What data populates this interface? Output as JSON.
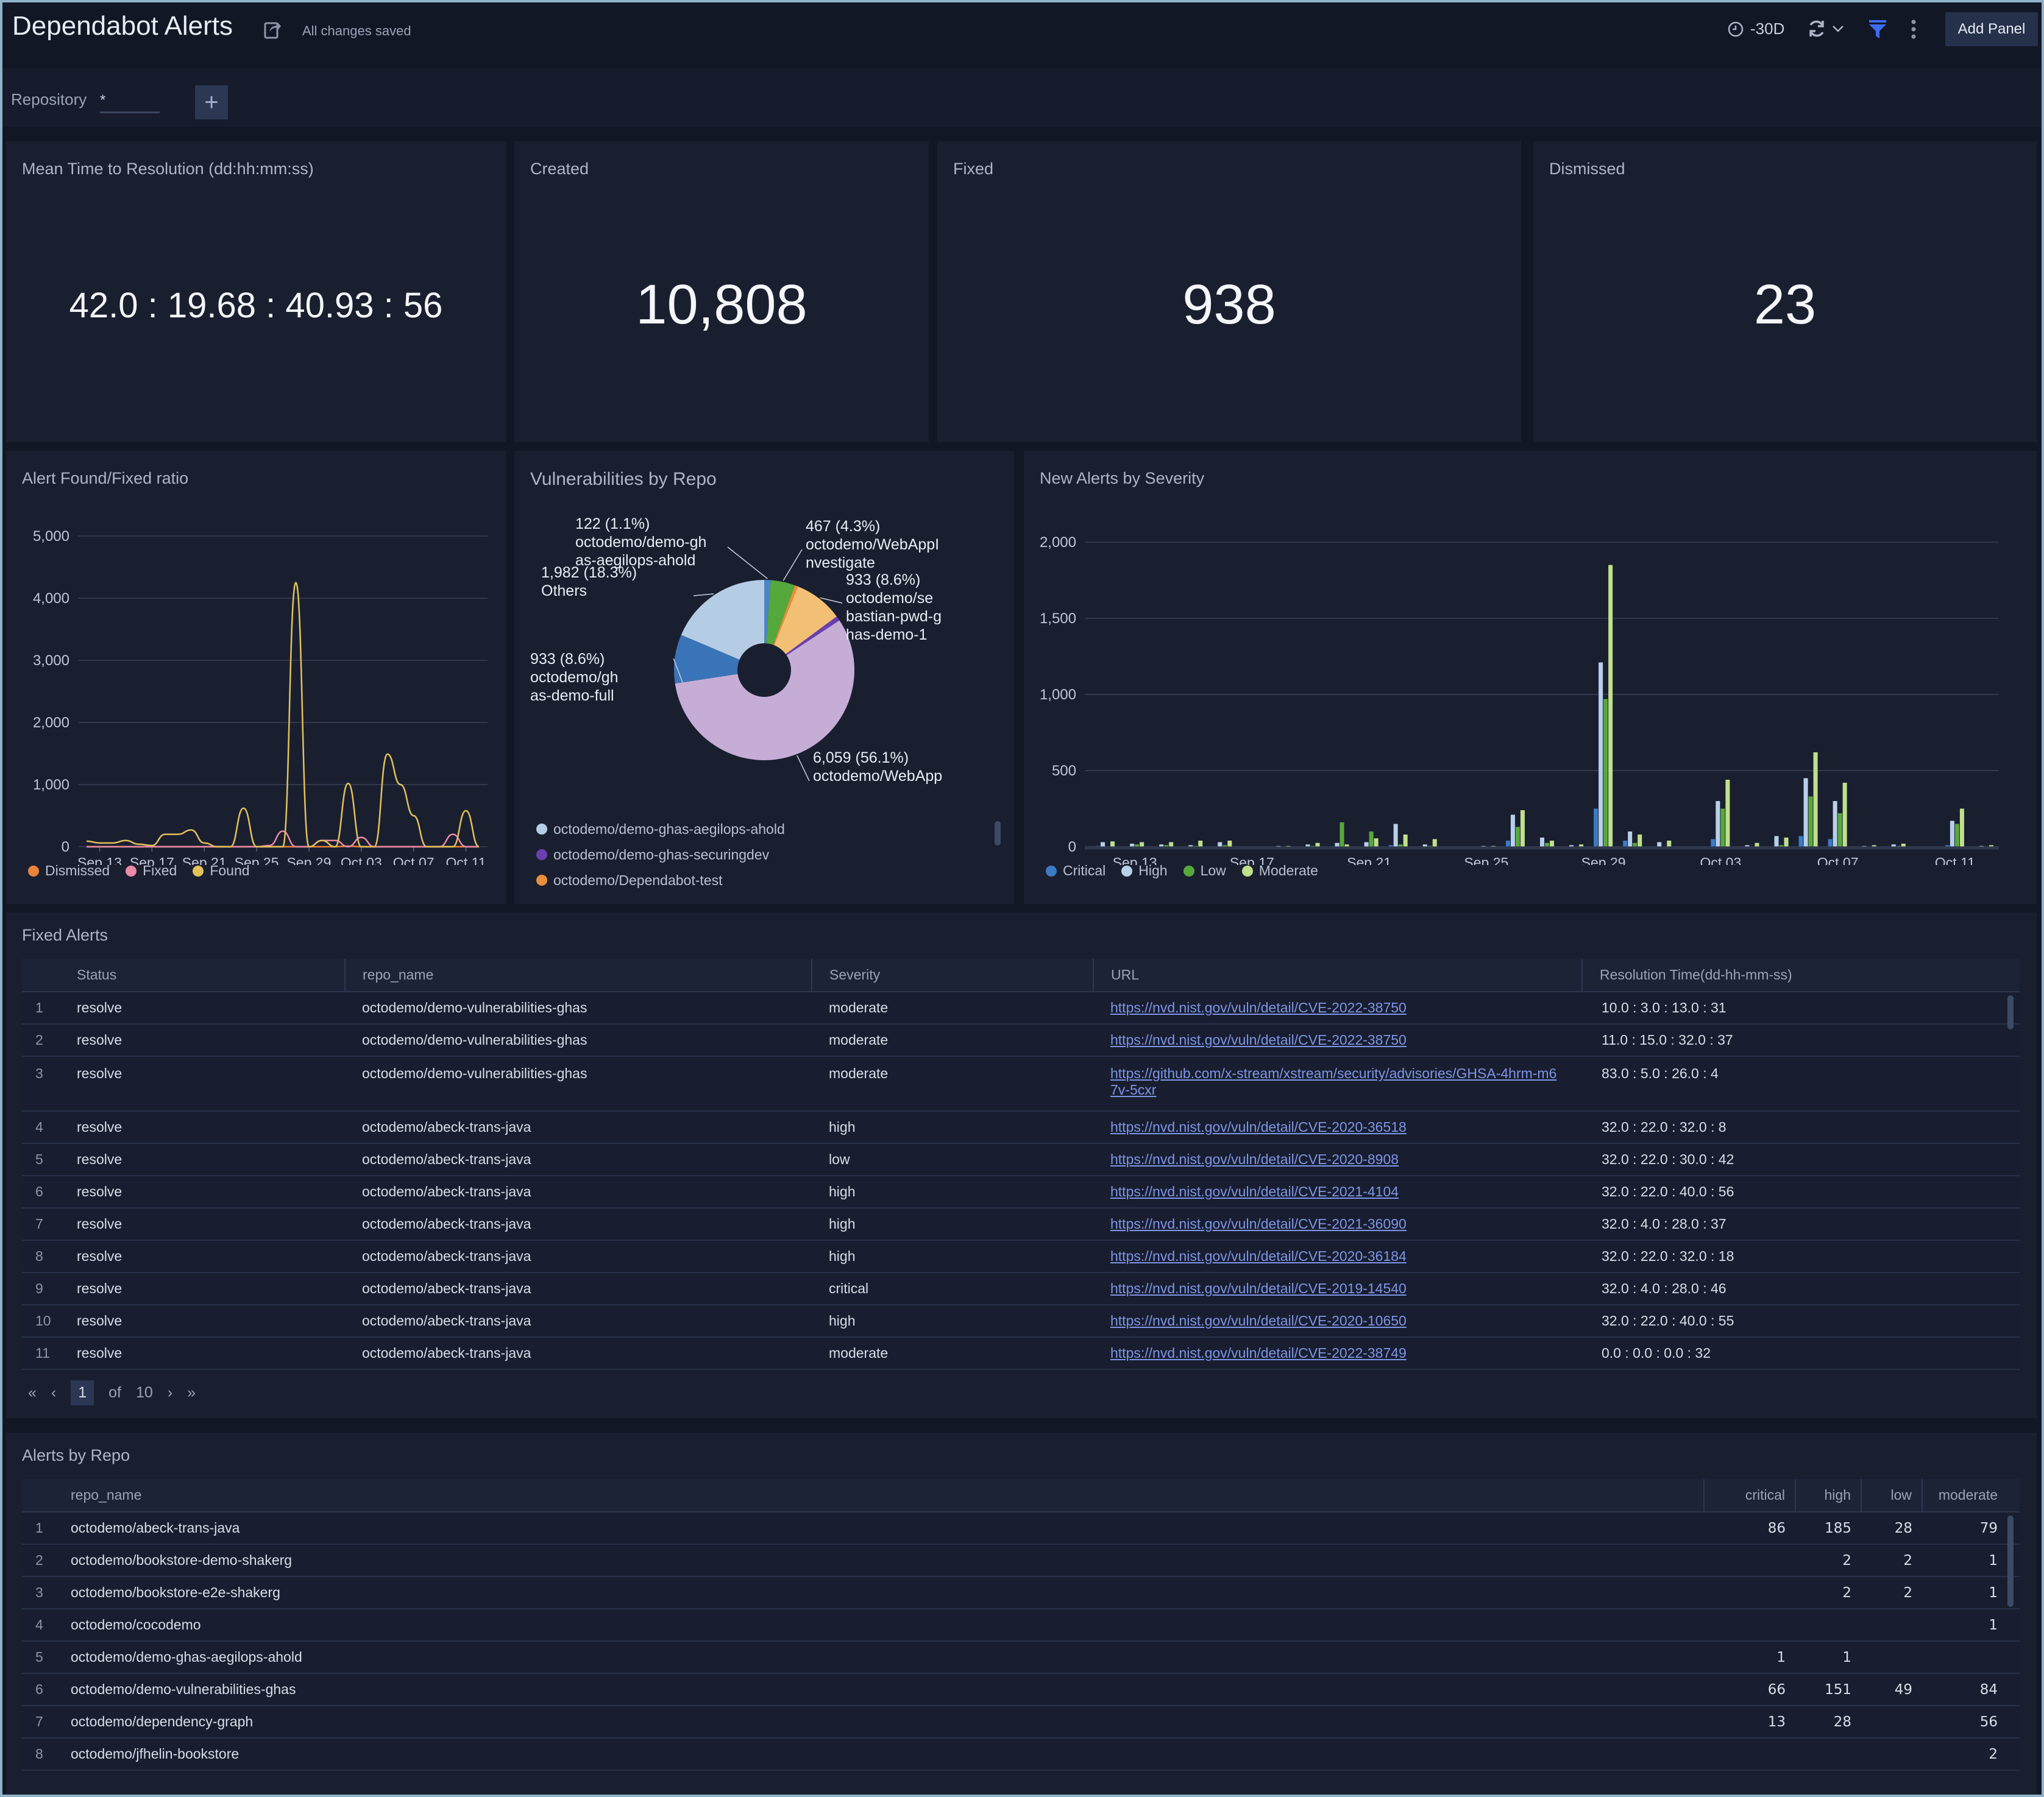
{
  "header": {
    "title": "Dependabot Alerts",
    "save_status": "All changes saved",
    "time_range": "-30D",
    "add_panel_label": "Add Panel"
  },
  "filters": {
    "repository_label": "Repository",
    "repository_value": "*"
  },
  "stats": [
    {
      "title": "Mean Time to Resolution (dd:hh:mm:ss)",
      "value": "42.0 : 19.68 : 40.93 : 56"
    },
    {
      "title": "Created",
      "value": "10,808"
    },
    {
      "title": "Fixed",
      "value": "938"
    },
    {
      "title": "Dismissed",
      "value": "23"
    }
  ],
  "chart_data": [
    {
      "type": "line",
      "title": "Alert Found/Fixed ratio",
      "xlabel": "",
      "ylabel": "",
      "ylim": [
        0,
        5000
      ],
      "yticks": [
        "0",
        "1,000",
        "2,000",
        "3,000",
        "4,000",
        "5,000"
      ],
      "x": [
        "Sep 12",
        "Sep 13",
        "Sep 14",
        "Sep 15",
        "Sep 16",
        "Sep 17",
        "Sep 18",
        "Sep 19",
        "Sep 20",
        "Sep 21",
        "Sep 22",
        "Sep 23",
        "Sep 24",
        "Sep 25",
        "Sep 26",
        "Sep 27",
        "Sep 28",
        "Sep 29",
        "Sep 30",
        "Oct 01",
        "Oct 02",
        "Oct 03",
        "Oct 04",
        "Oct 05",
        "Oct 06",
        "Oct 07",
        "Oct 08",
        "Oct 09",
        "Oct 10",
        "Oct 11",
        "Oct 12"
      ],
      "xticks": [
        "Sep 13",
        "Sep 17",
        "Sep 21",
        "Sep 25",
        "Sep 29",
        "Oct 03",
        "Oct 07",
        "Oct 11"
      ],
      "legend": "bottom-left",
      "grid": true,
      "series": [
        {
          "name": "Dismissed",
          "color": "#e8843a",
          "values": [
            0,
            0,
            0,
            0,
            0,
            0,
            0,
            0,
            0,
            0,
            0,
            0,
            0,
            0,
            0,
            0,
            0,
            0,
            0,
            0,
            10,
            0,
            0,
            0,
            0,
            0,
            0,
            0,
            0,
            0,
            0
          ]
        },
        {
          "name": "Fixed",
          "color": "#e98aa6",
          "values": [
            0,
            0,
            0,
            0,
            0,
            0,
            0,
            0,
            0,
            0,
            0,
            0,
            0,
            0,
            20,
            250,
            0,
            0,
            100,
            100,
            0,
            150,
            0,
            0,
            0,
            0,
            0,
            0,
            200,
            0,
            0
          ]
        },
        {
          "name": "Found",
          "color": "#e2c15a",
          "values": [
            90,
            60,
            60,
            100,
            40,
            20,
            200,
            200,
            270,
            60,
            0,
            0,
            620,
            0,
            0,
            0,
            4250,
            0,
            100,
            0,
            1020,
            0,
            0,
            1490,
            1000,
            500,
            0,
            0,
            0,
            580,
            0
          ]
        }
      ]
    },
    {
      "type": "pie",
      "title": "Vulnerabilities by Repo",
      "slices": [
        {
          "label": "octodemo/WebApp",
          "value": 6059,
          "pct": "56.1%",
          "color": "#c6add6",
          "annotation": [
            "6,059 (56.1%)",
            "octodemo/WebApp"
          ]
        },
        {
          "label": "octodemo/ghas-demo-full",
          "value": 933,
          "pct": "8.6%",
          "color": "#3a74b8",
          "annotation": [
            "933 (8.6%)",
            "octodemo/gh",
            "as-demo-full"
          ]
        },
        {
          "label": "Others",
          "value": 1982,
          "pct": "18.3%",
          "color": "#b5cde4",
          "annotation": [
            "1,982 (18.3%)",
            "Others"
          ]
        },
        {
          "label": "octodemo/demo-ghas-aegilops-ahold",
          "value": 122,
          "pct": "1.1%",
          "color": "#4a86c8",
          "annotation": [
            "122 (1.1%)",
            "octodemo/demo-gh",
            "as-aegilops-ahold"
          ]
        },
        {
          "label": "octodemo/WebAppInvestigate",
          "value": 467,
          "pct": "4.3%",
          "color": "#55a83b",
          "annotation": [
            "467 (4.3%)",
            "octodemo/WebAppI",
            "nvestigate"
          ]
        },
        {
          "label": "octodemo/Dependabot-test",
          "value": 60,
          "pct": "0.6%",
          "color": "#e98e3a",
          "annotation": []
        },
        {
          "label": "octodemo/sebastian-pwd-ghas-demo-1",
          "value": 933,
          "pct": "8.6%",
          "color": "#f2c074",
          "annotation": [
            "933 (8.6%)",
            "octodemo/se",
            "bastian-pwd-g",
            "has-demo-1"
          ]
        },
        {
          "label": "octodemo/demo-ghas-securingdev",
          "value": 90,
          "pct": "0.8%",
          "color": "#6a3fb0",
          "annotation": []
        }
      ],
      "legend_items": [
        {
          "label": "octodemo/demo-ghas-aegilops-ahold",
          "color": "#b5cde4"
        },
        {
          "label": "octodemo/demo-ghas-securingdev",
          "color": "#6a3fb0"
        },
        {
          "label": "octodemo/Dependabot-test",
          "color": "#e98e3a"
        }
      ]
    },
    {
      "type": "bar",
      "title": "New Alerts by Severity",
      "xlabel": "",
      "ylabel": "",
      "ylim": [
        0,
        2000
      ],
      "yticks": [
        "0",
        "500",
        "1,000",
        "1,500",
        "2,000"
      ],
      "categories": [
        "Sep 12",
        "Sep 13",
        "Sep 14",
        "Sep 15",
        "Sep 16",
        "Sep 17",
        "Sep 18",
        "Sep 19",
        "Sep 20",
        "Sep 21",
        "Sep 22",
        "Sep 23",
        "Sep 24",
        "Sep 25",
        "Sep 26",
        "Sep 27",
        "Sep 28",
        "Sep 29",
        "Sep 30",
        "Oct 01",
        "Oct 02",
        "Oct 03",
        "Oct 04",
        "Oct 05",
        "Oct 06",
        "Oct 07",
        "Oct 08",
        "Oct 09",
        "Oct 10",
        "Oct 11",
        "Oct 12"
      ],
      "xticks": [
        "Sep 13",
        "Sep 17",
        "Sep 21",
        "Sep 25",
        "Sep 29",
        "Oct 03",
        "Oct 07",
        "Oct 11"
      ],
      "legend": "bottom-left",
      "grid": true,
      "series": [
        {
          "name": "Critical",
          "color": "#3b7bc4",
          "values": [
            5,
            0,
            0,
            0,
            0,
            0,
            0,
            0,
            0,
            0,
            10,
            0,
            0,
            0,
            40,
            0,
            0,
            250,
            40,
            0,
            0,
            50,
            0,
            0,
            70,
            50,
            0,
            0,
            0,
            10,
            0
          ]
        },
        {
          "name": "High",
          "color": "#b7d0ea",
          "values": [
            30,
            20,
            15,
            10,
            30,
            0,
            5,
            15,
            25,
            30,
            150,
            15,
            0,
            5,
            210,
            60,
            10,
            1210,
            100,
            30,
            0,
            300,
            10,
            70,
            450,
            300,
            5,
            15,
            0,
            170,
            5
          ]
        },
        {
          "name": "Low",
          "color": "#57a83d",
          "values": [
            0,
            15,
            10,
            5,
            10,
            0,
            0,
            5,
            160,
            100,
            15,
            5,
            0,
            0,
            130,
            25,
            0,
            970,
            25,
            0,
            0,
            250,
            0,
            10,
            330,
            220,
            0,
            5,
            0,
            150,
            0
          ]
        },
        {
          "name": "Moderate",
          "color": "#c1df8c",
          "values": [
            35,
            30,
            30,
            40,
            40,
            0,
            5,
            25,
            15,
            55,
            80,
            50,
            0,
            5,
            240,
            40,
            15,
            1850,
            80,
            40,
            0,
            440,
            25,
            60,
            620,
            420,
            10,
            20,
            0,
            250,
            10
          ]
        }
      ]
    }
  ],
  "fixed_alerts": {
    "title": "Fixed Alerts",
    "columns": [
      "Status",
      "repo_name",
      "Severity",
      "URL",
      "Resolution Time(dd-hh-mm-ss)"
    ],
    "rows": [
      {
        "idx": "1",
        "status": "resolve",
        "repo": "octodemo/demo-vulnerabilities-ghas",
        "severity": "moderate",
        "url": "https://nvd.nist.gov/vuln/detail/CVE-2022-38750",
        "time": "10.0 : 3.0 : 13.0 : 31"
      },
      {
        "idx": "2",
        "status": "resolve",
        "repo": "octodemo/demo-vulnerabilities-ghas",
        "severity": "moderate",
        "url": "https://nvd.nist.gov/vuln/detail/CVE-2022-38750",
        "time": "11.0 : 15.0 : 32.0 : 37"
      },
      {
        "idx": "3",
        "status": "resolve",
        "repo": "octodemo/demo-vulnerabilities-ghas",
        "severity": "moderate",
        "url": "https://github.com/x-stream/xstream/security/advisories/GHSA-4hrm-m67v-5cxr",
        "time": "83.0 : 5.0 : 26.0 : 4"
      },
      {
        "idx": "4",
        "status": "resolve",
        "repo": "octodemo/abeck-trans-java",
        "severity": "high",
        "url": "https://nvd.nist.gov/vuln/detail/CVE-2020-36518",
        "time": "32.0 : 22.0 : 32.0 : 8"
      },
      {
        "idx": "5",
        "status": "resolve",
        "repo": "octodemo/abeck-trans-java",
        "severity": "low",
        "url": "https://nvd.nist.gov/vuln/detail/CVE-2020-8908",
        "time": "32.0 : 22.0 : 30.0 : 42"
      },
      {
        "idx": "6",
        "status": "resolve",
        "repo": "octodemo/abeck-trans-java",
        "severity": "high",
        "url": "https://nvd.nist.gov/vuln/detail/CVE-2021-4104",
        "time": "32.0 : 22.0 : 40.0 : 56"
      },
      {
        "idx": "7",
        "status": "resolve",
        "repo": "octodemo/abeck-trans-java",
        "severity": "high",
        "url": "https://nvd.nist.gov/vuln/detail/CVE-2021-36090",
        "time": "32.0 : 4.0 : 28.0 : 37"
      },
      {
        "idx": "8",
        "status": "resolve",
        "repo": "octodemo/abeck-trans-java",
        "severity": "high",
        "url": "https://nvd.nist.gov/vuln/detail/CVE-2020-36184",
        "time": "32.0 : 22.0 : 32.0 : 18"
      },
      {
        "idx": "9",
        "status": "resolve",
        "repo": "octodemo/abeck-trans-java",
        "severity": "critical",
        "url": "https://nvd.nist.gov/vuln/detail/CVE-2019-14540",
        "time": "32.0 : 4.0 : 28.0 : 46"
      },
      {
        "idx": "10",
        "status": "resolve",
        "repo": "octodemo/abeck-trans-java",
        "severity": "high",
        "url": "https://nvd.nist.gov/vuln/detail/CVE-2020-10650",
        "time": "32.0 : 22.0 : 40.0 : 55"
      },
      {
        "idx": "11",
        "status": "resolve",
        "repo": "octodemo/abeck-trans-java",
        "severity": "moderate",
        "url": "https://nvd.nist.gov/vuln/detail/CVE-2022-38749",
        "time": "0.0 : 0.0 : 0.0 : 32"
      }
    ],
    "pager": {
      "current": "1",
      "of_label": "of",
      "total": "10"
    }
  },
  "alerts_by_repo": {
    "title": "Alerts by Repo",
    "columns": [
      "repo_name",
      "critical",
      "high",
      "low",
      "moderate"
    ],
    "rows": [
      {
        "idx": "1",
        "repo": "octodemo/abeck-trans-java",
        "critical": "86",
        "high": "185",
        "low": "28",
        "moderate": "79"
      },
      {
        "idx": "2",
        "repo": "octodemo/bookstore-demo-shakerg",
        "critical": "",
        "high": "2",
        "low": "2",
        "moderate": "1"
      },
      {
        "idx": "3",
        "repo": "octodemo/bookstore-e2e-shakerg",
        "critical": "",
        "high": "2",
        "low": "2",
        "moderate": "1"
      },
      {
        "idx": "4",
        "repo": "octodemo/cocodemo",
        "critical": "",
        "high": "",
        "low": "",
        "moderate": "1"
      },
      {
        "idx": "5",
        "repo": "octodemo/demo-ghas-aegilops-ahold",
        "critical": "1",
        "high": "1",
        "low": "",
        "moderate": ""
      },
      {
        "idx": "6",
        "repo": "octodemo/demo-vulnerabilities-ghas",
        "critical": "66",
        "high": "151",
        "low": "49",
        "moderate": "84"
      },
      {
        "idx": "7",
        "repo": "octodemo/dependency-graph",
        "critical": "13",
        "high": "28",
        "low": "",
        "moderate": "56"
      },
      {
        "idx": "8",
        "repo": "octodemo/jfhelin-bookstore",
        "critical": "",
        "high": "",
        "low": "",
        "moderate": "2"
      }
    ]
  }
}
